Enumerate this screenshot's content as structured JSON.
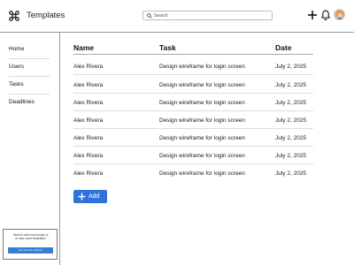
{
  "header": {
    "title": "Templates",
    "search_placeholder": "Search",
    "icons": [
      "command-icon",
      "search-icon",
      "plus-icon",
      "bell-icon"
    ]
  },
  "sidebar": {
    "items": [
      {
        "label": "Home"
      },
      {
        "label": "Users"
      },
      {
        "label": "Tasks"
      },
      {
        "label": "Deadlines"
      }
    ],
    "promo": {
      "text": "Want to add more people or to have more templates?",
      "button_label": "Get The Pro Version"
    }
  },
  "table": {
    "columns": [
      "Name",
      "Task",
      "Date"
    ],
    "rows": [
      {
        "name": "Alex Rivera",
        "task": "Design wireframe for login screen",
        "date": "July 2, 2025"
      },
      {
        "name": "Alex Rivera",
        "task": "Design wireframe for login screen",
        "date": "July 2, 2025"
      },
      {
        "name": "Alex Rivera",
        "task": "Design wireframe for login screen",
        "date": "July 2, 2025"
      },
      {
        "name": "Alex Rivera",
        "task": "Design wireframe for login screen",
        "date": "July 2, 2025"
      },
      {
        "name": "Alex Rivera",
        "task": "Design wireframe for login screen",
        "date": "July 2, 2025"
      },
      {
        "name": "Alex Rivera",
        "task": "Design wireframe for login screen",
        "date": "July 2, 2025"
      },
      {
        "name": "Alex Rivera",
        "task": "Design wireframe for login screen",
        "date": "July 2, 2025"
      }
    ]
  },
  "add_button": {
    "label": "Add"
  },
  "colors": {
    "accent": "#2f72de",
    "border": "#9a9a9a",
    "row_divider": "#dcdcdc"
  }
}
